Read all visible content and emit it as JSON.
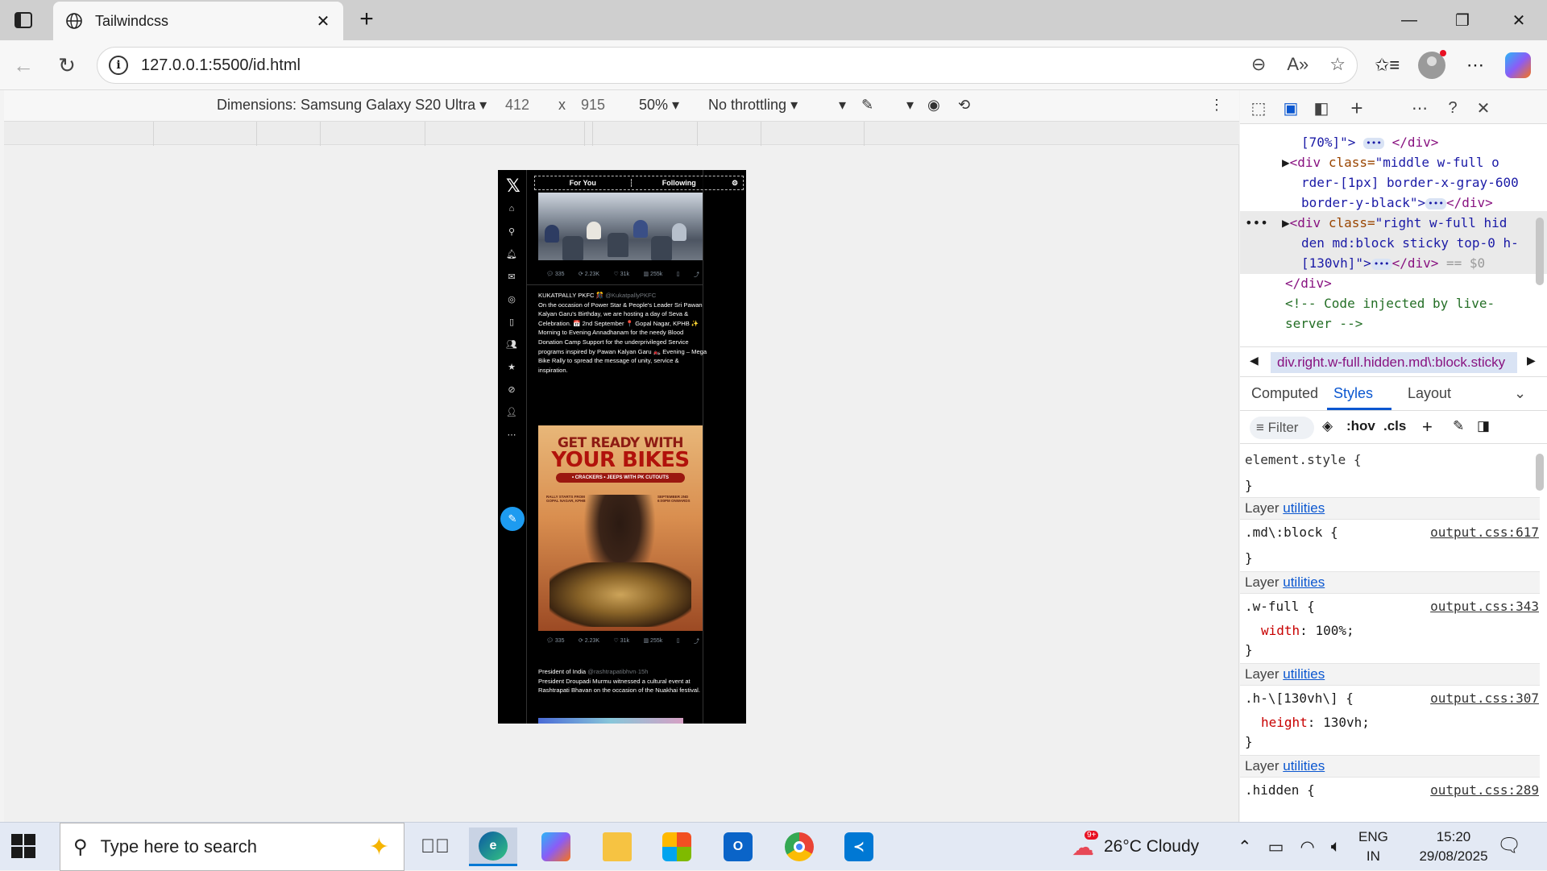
{
  "browser": {
    "tab_title": "Tailwindcss",
    "url": "127.0.0.1:5500/id.html"
  },
  "device_toolbar": {
    "dimensions_label": "Dimensions: Samsung Galaxy S20 Ultra",
    "width": "412",
    "times": "x",
    "height": "915",
    "zoom": "50%",
    "throttling": "No throttling"
  },
  "phone": {
    "tabs": {
      "for_you": "For You",
      "following": "Following"
    },
    "post1_actions": {
      "replies": "335",
      "reposts": "2.23K",
      "likes": "31k",
      "views": "255k"
    },
    "post2": {
      "author": "KUKATPALLY PKFC 🎊",
      "handle": "@KukatpallyPKFC",
      "text": "On the occasion of Power Star & People's Leader Sri Pawan Kalyan Garu's Birthday, we are hosting a day of Seva & Celebration. 📅 2nd September 📍 Gopal Nagar, KPHB ✨ Morning to Evening Annadhanam for the needy Blood Donation Camp Support for the underprivileged Service programs inspired by Pawan Kalyan Garu 🏍️ Evening – Mega Bike Rally to spread the message of unity, service & inspiration."
    },
    "poster": {
      "line1": "GET READY WITH",
      "line2": "YOUR BIKES",
      "strip": "• CRACKERS • JEEPS WITH PK CUTOUTS",
      "left_small": "RALLY STARTS FROM GOPAL NAGAR, KPHB",
      "right_small": "SEPTEMBER 2ND 6:00PM ONWARDS"
    },
    "post2_actions": {
      "replies": "335",
      "reposts": "2.23K",
      "likes": "31k",
      "views": "255k"
    },
    "post3": {
      "author": "President of India",
      "handle": "@rashtrapatibhvn·15h",
      "text": "President Droupadi Murmu witnessed a cultural event at Rashtrapati Bhavan on the occasion of the Nuakhai festival."
    }
  },
  "devtools": {
    "dom": {
      "l1": "[70%]\">",
      "l1_close": "</div>",
      "l2_tag": "<div ",
      "l2_attr": "class=",
      "l2_val": "\"middle w-full o",
      "l3": "rder-[1px] border-x-gray-600",
      "l4": "border-y-black\">",
      "l5_tag": "<div ",
      "l5_attr": "class=",
      "l5_val": "\"right w-full hid",
      "l6": "den md:block sticky top-0 h-",
      "l7": "[130vh]\">",
      "l7_suffix": "== $0",
      "l8": "</div>",
      "l9": "<!-- Code injected by live-",
      "l10": "server -->"
    },
    "breadcrumb": "div.right.w-full.hidden.md\\:block.sticky",
    "tabs": {
      "computed": "Computed",
      "styles": "Styles",
      "layout": "Layout"
    },
    "filter": "Filter",
    "hov": ":hov",
    "cls": ".cls",
    "rules": {
      "element_style": "element.style {",
      "close": "}",
      "layer_label": "Layer ",
      "layer_link": "utilities",
      "r1_selector": ".md\\:block {",
      "r1_src": "output.css:617",
      "r2_selector": ".w-full {",
      "r2_prop": "width",
      "r2_val": ": 100%;",
      "r2_src": "output.css:343",
      "r3_selector": ".h-\\[130vh\\] {",
      "r3_prop": "height",
      "r3_val": ": 130vh;",
      "r3_src": "output.css:307",
      "r4_selector": ".hidden {",
      "r4_src": "output.css:289"
    }
  },
  "taskbar": {
    "search_placeholder": "Type here to search",
    "weather": "26°C  Cloudy",
    "weather_badge": "9+",
    "lang1": "ENG",
    "lang2": "IN",
    "time": "15:20",
    "date": "29/08/2025"
  }
}
